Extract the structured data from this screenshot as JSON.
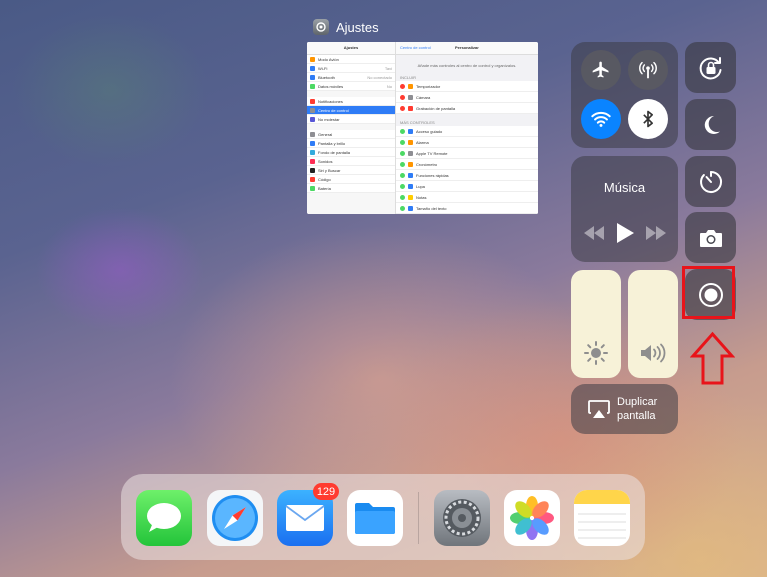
{
  "app_switcher": {
    "app_name": "Ajustes",
    "preview": {
      "left_title": "Ajustes",
      "left_items": [
        "Modo Avión",
        "Wi-Fi",
        "Bluetooth",
        "Datos móviles",
        "Notificaciones",
        "Centro de control",
        "No molestar",
        "General",
        "Pantalla y brillo",
        "Fondo de pantalla",
        "Sonidos",
        "Siri y Buscar",
        "Código",
        "Batería"
      ],
      "left_values": [
        "",
        "Tavi",
        "No conectado",
        "No"
      ],
      "back_label": "Centro de control",
      "right_title": "Personalizar",
      "description": "Añade más controles al centro de control y organízalos.",
      "section_include": "INCLUIR",
      "include_items": [
        "Temporizador",
        "Cámara",
        "Grabación de pantalla"
      ],
      "section_more": "MÁS CONTROLES",
      "more_items": [
        "Acceso guiado",
        "Alarma",
        "Apple TV Remote",
        "Cronómetro",
        "Funciones rápidas",
        "Lupa",
        "Notas",
        "Tamaño del texto"
      ]
    }
  },
  "control_center": {
    "music_title": "Música",
    "mirror_label_line1": "Duplicar",
    "mirror_label_line2": "pantalla",
    "buttons": [
      "airplane-mode",
      "cellular-data",
      "wifi",
      "bluetooth",
      "orientation-lock",
      "do-not-disturb",
      "timer",
      "camera",
      "screen-recording"
    ],
    "wifi_on": true,
    "bluetooth_on": true,
    "brightness_level": 1.0,
    "volume_level": 1.0
  },
  "dock": {
    "apps": [
      "Mensajes",
      "Safari",
      "Mail",
      "Archivos",
      "Ajustes",
      "Fotos",
      "Notas"
    ],
    "mail_badge": "129"
  },
  "colors": {
    "highlight": "#e8141a",
    "wifi_blue": "#0a84ff",
    "badge_red": "#ff3b30"
  }
}
